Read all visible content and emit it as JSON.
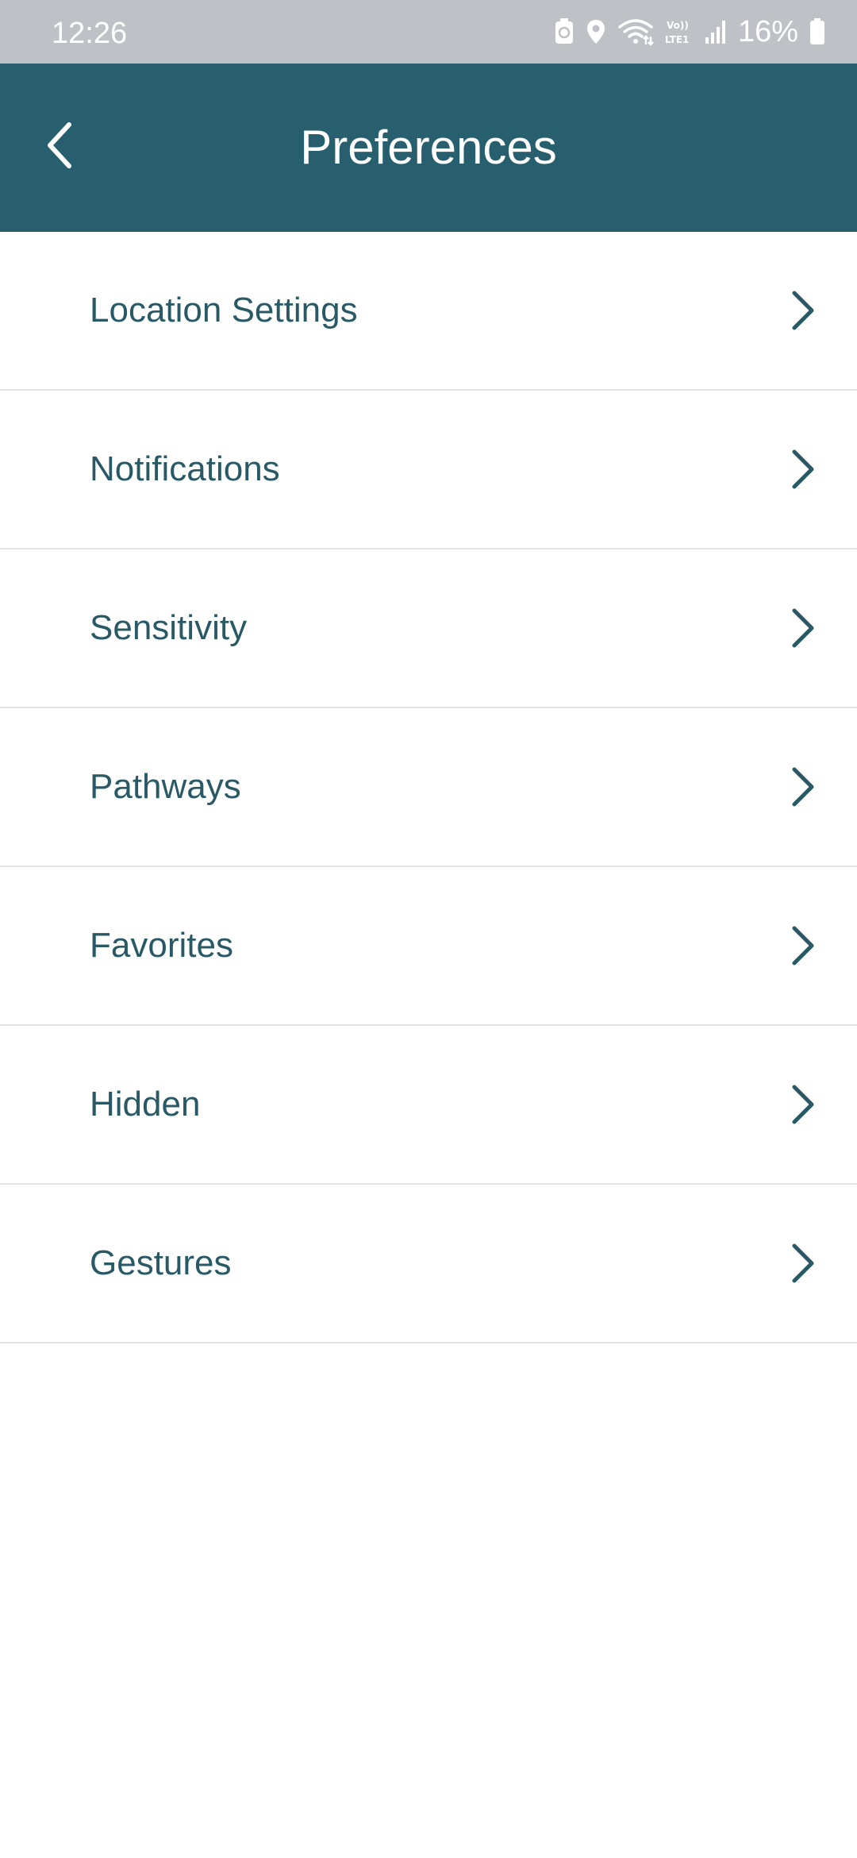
{
  "status_bar": {
    "time": "12:26",
    "battery": "16%",
    "icons": [
      "battery-saver-icon",
      "location-icon",
      "wifi-icon",
      "volte-lte-icon",
      "signal-icon",
      "battery-icon"
    ]
  },
  "header": {
    "title": "Preferences",
    "back_icon": "back-arrow-icon",
    "background_color": "#285f6e"
  },
  "menu": {
    "items": [
      {
        "label": "Location Settings"
      },
      {
        "label": "Notifications"
      },
      {
        "label": "Sensitivity"
      },
      {
        "label": "Pathways"
      },
      {
        "label": "Favorites"
      },
      {
        "label": "Hidden"
      },
      {
        "label": "Gestures"
      }
    ],
    "text_color": "#2a5966"
  }
}
